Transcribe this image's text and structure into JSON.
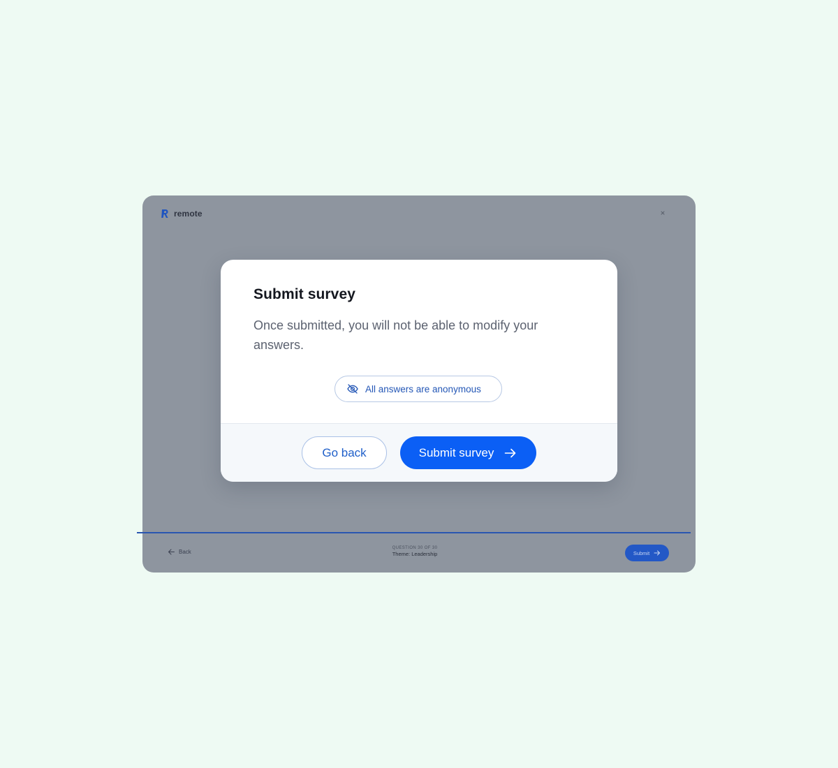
{
  "app": {
    "brand_name": "remote",
    "brand_color": "#2457b6",
    "close_icon": "close-icon"
  },
  "footer": {
    "back_label": "Back",
    "question_counter": "QUESTION 30 OF 30",
    "theme_label": "Theme: Leadership",
    "submit_label": "Submit",
    "progress_fraction": 1.0
  },
  "modal": {
    "title": "Submit survey",
    "message": "Once submitted, you will not be able to modify your answers.",
    "anonymous_badge": {
      "label": "All answers are anonymous",
      "icon": "eye-off-icon"
    },
    "go_back_label": "Go back",
    "submit_label": "Submit survey",
    "submit_icon": "arrow-right-icon",
    "accent_color": "#0b5ff5"
  }
}
